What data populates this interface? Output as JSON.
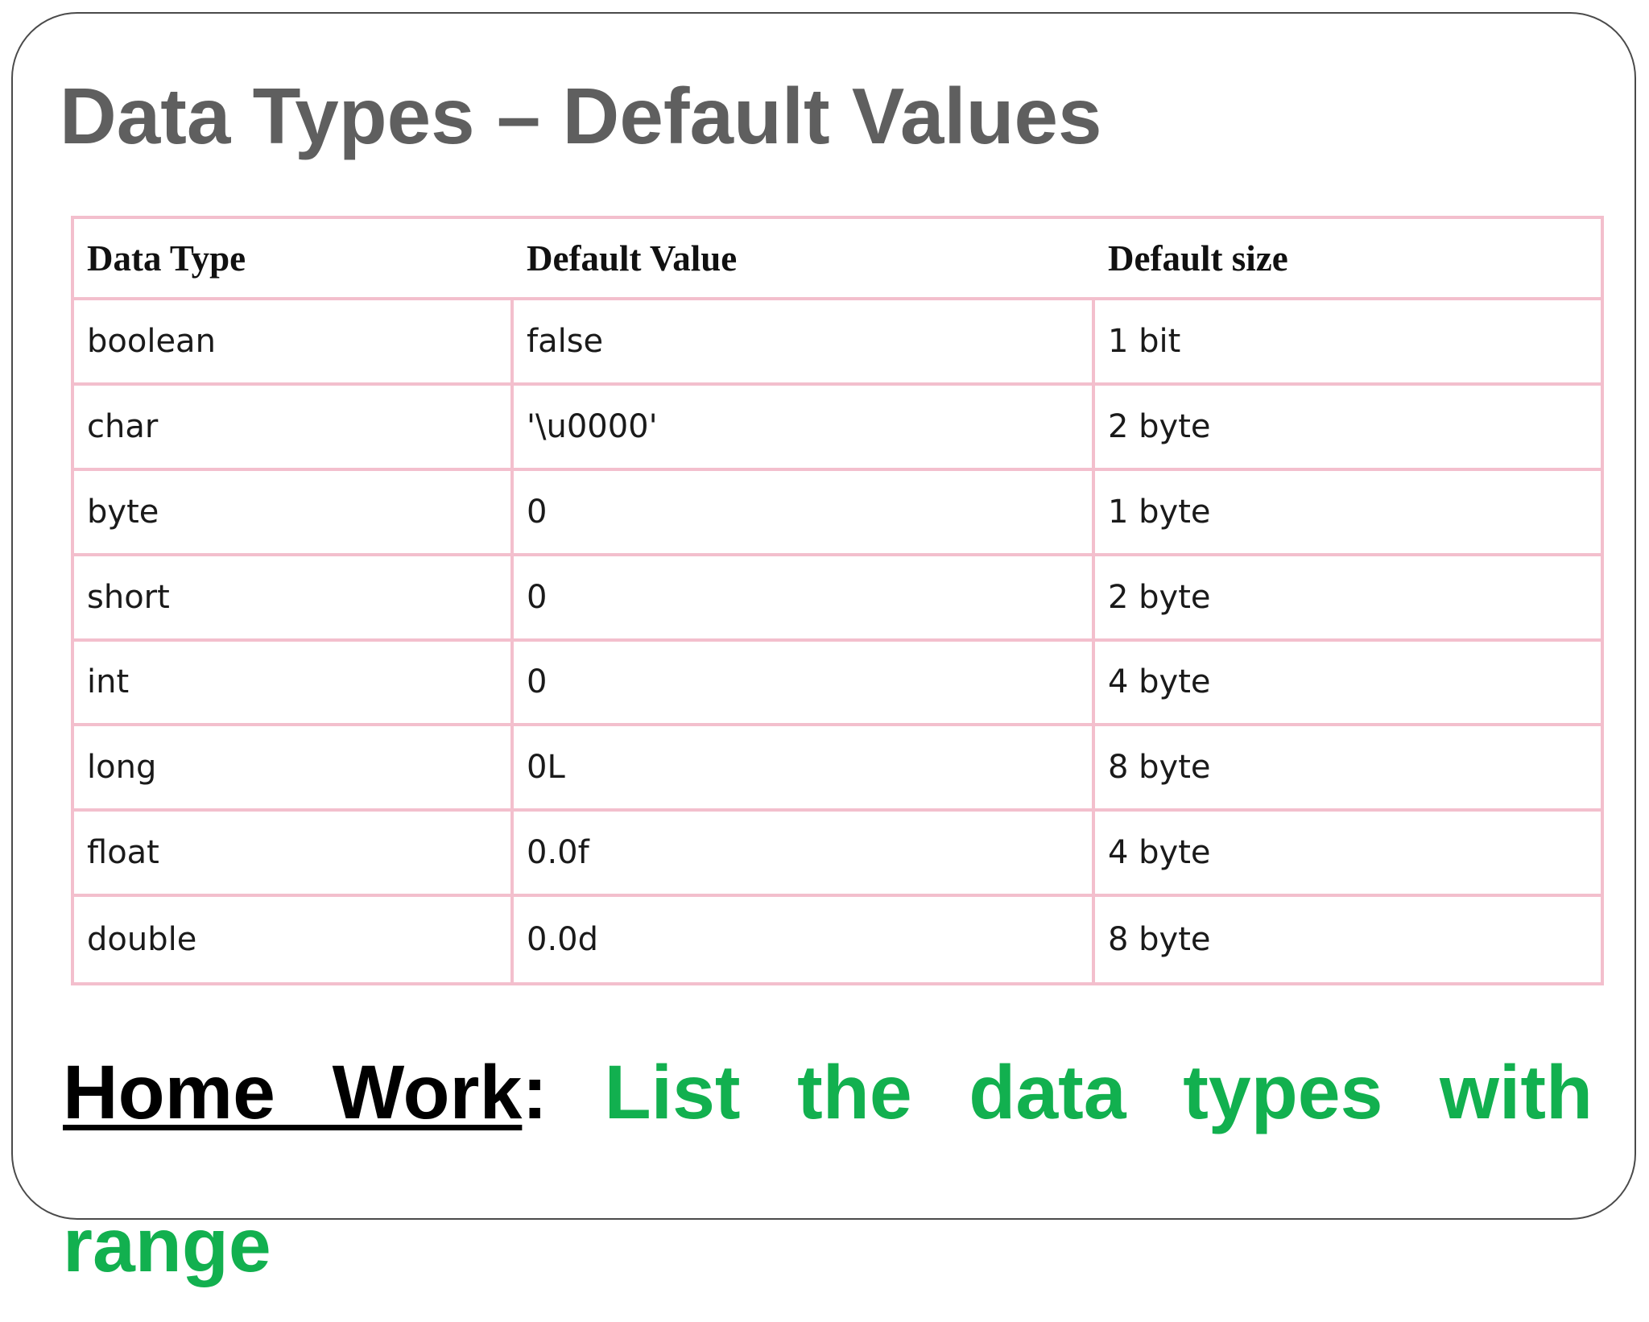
{
  "slide": {
    "title": "Data Types – Default Values"
  },
  "table": {
    "headers": [
      "Data Type",
      "Default Value",
      "Default size"
    ],
    "rows": [
      [
        "boolean",
        "false",
        "1 bit"
      ],
      [
        "char",
        "'\\u0000'",
        "2 byte"
      ],
      [
        "byte",
        "0",
        "1 byte"
      ],
      [
        "short",
        "0",
        "2 byte"
      ],
      [
        "int",
        "0",
        "4 byte"
      ],
      [
        "long",
        "0L",
        "8 byte"
      ],
      [
        "float",
        "0.0f",
        "4 byte"
      ],
      [
        "double",
        "0.0d",
        "8 byte"
      ]
    ]
  },
  "homework": {
    "label": "Home Work",
    "colon": ":",
    "task": "List the data types with range"
  },
  "colors": {
    "title": "#5f5f5f",
    "table_border": "#f3bfcd",
    "task_text": "#12b04f",
    "frame": "#4a4a4a"
  }
}
